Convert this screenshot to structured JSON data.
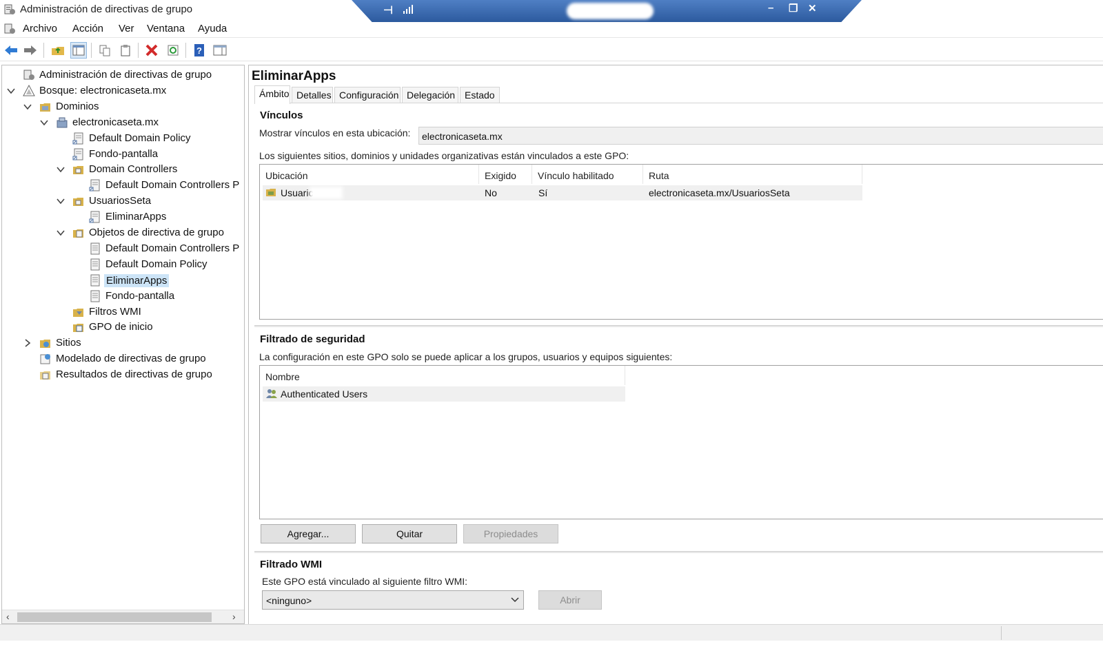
{
  "window": {
    "title": "Administración de directivas de grupo"
  },
  "menu": {
    "items": [
      "Archivo",
      "Acción",
      "Ver",
      "Ventana",
      "Ayuda"
    ]
  },
  "toolbar": {
    "icons": [
      "back-arrow-icon",
      "forward-arrow-icon",
      "up-folder-icon",
      "show-hide-tree-icon",
      "copy-icon",
      "paste-icon",
      "delete-icon",
      "refresh-icon",
      "help-icon",
      "properties-pane-icon"
    ]
  },
  "tree": {
    "items": [
      {
        "label": "Administración de directivas de grupo",
        "icon": "gpmc-icon"
      },
      {
        "label": "Bosque: electronicaseta.mx",
        "icon": "forest-icon"
      },
      {
        "label": "Dominios",
        "icon": "domains-icon"
      },
      {
        "label": "electronicaseta.mx",
        "icon": "domain-icon"
      },
      {
        "label": "Default Domain Policy",
        "icon": "gpo-link-icon"
      },
      {
        "label": "Fondo-pantalla",
        "icon": "gpo-link-icon"
      },
      {
        "label": "Domain Controllers",
        "icon": "ou-folder-icon"
      },
      {
        "label": "Default Domain Controllers P",
        "icon": "gpo-link-icon"
      },
      {
        "label": "UsuariosSeta",
        "icon": "ou-folder-icon"
      },
      {
        "label": "EliminarApps",
        "icon": "gpo-link-icon"
      },
      {
        "label": "Objetos de directiva de grupo",
        "icon": "gpo-container-icon"
      },
      {
        "label": "Default Domain Controllers P",
        "icon": "gpo-icon"
      },
      {
        "label": "Default Domain Policy",
        "icon": "gpo-icon"
      },
      {
        "label": "EliminarApps",
        "icon": "gpo-icon"
      },
      {
        "label": "Fondo-pantalla",
        "icon": "gpo-icon"
      },
      {
        "label": "Filtros WMI",
        "icon": "wmi-filter-icon"
      },
      {
        "label": "GPO de inicio",
        "icon": "starter-gpo-icon"
      },
      {
        "label": "Sitios",
        "icon": "sites-icon"
      },
      {
        "label": "Modelado de directivas de grupo",
        "icon": "modeling-icon"
      },
      {
        "label": "Resultados de directivas de grupo",
        "icon": "results-icon"
      }
    ],
    "selected": "EliminarApps"
  },
  "details": {
    "title": "EliminarApps",
    "tabs": [
      "Ámbito",
      "Detalles",
      "Configuración",
      "Delegación",
      "Estado"
    ],
    "active_tab": "Ámbito",
    "links": {
      "heading": "Vínculos",
      "show_links_label": "Mostrar vínculos en esta ubicación:",
      "show_links_value": "electronicaseta.mx",
      "description": "Los siguientes sitios, dominios y unidades organizativas están vinculados a este GPO:",
      "columns": [
        "Ubicación",
        "Exigido",
        "Vínculo habilitado",
        "Ruta"
      ],
      "rows": [
        {
          "location": "Usuaric",
          "enforced": "No",
          "enabled": "Sí",
          "path": "electronicaseta.mx/UsuariosSeta"
        }
      ]
    },
    "security": {
      "heading": "Filtrado de seguridad",
      "description": "La configuración en este GPO solo se puede aplicar a los grupos, usuarios y equipos siguientes:",
      "columns": [
        "Nombre"
      ],
      "rows": [
        "Authenticated Users"
      ],
      "buttons": {
        "add": "Agregar...",
        "remove": "Quitar",
        "properties": "Propiedades"
      }
    },
    "wmi": {
      "heading": "Filtrado WMI",
      "description": "Este GPO está vinculado al siguiente filtro WMI:",
      "selected": "<ninguno>",
      "open_button": "Abrir"
    }
  },
  "colors": {
    "rd_bar": "#3a6ab3",
    "selection": "#cce4f7",
    "delete_red": "#d22b2b",
    "help_blue": "#2b5fb8"
  }
}
